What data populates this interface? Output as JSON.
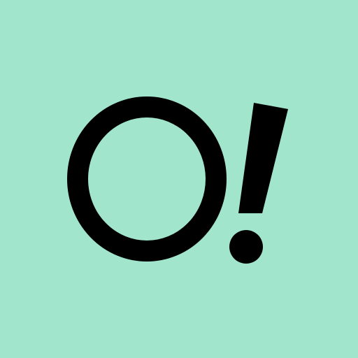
{
  "logo": {
    "text": "O!",
    "background_color": "#a1e5cd",
    "mark_color": "#000000"
  }
}
